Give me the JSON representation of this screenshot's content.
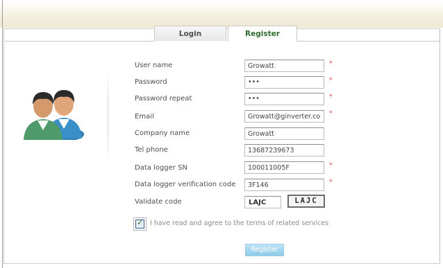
{
  "tabs": {
    "login": "Login",
    "register": "Register"
  },
  "form": {
    "rows": [
      {
        "label": "User name",
        "value": "Growatt",
        "type": "text",
        "required": true
      },
      {
        "label": "Password",
        "value": "•••",
        "type": "password",
        "required": true
      },
      {
        "label": "Password repeat",
        "value": "•••",
        "type": "password",
        "required": true
      },
      {
        "label": "Email",
        "value": "Growatt@ginverter.com",
        "type": "text",
        "required": true
      },
      {
        "label": "Company name",
        "value": "Growatt",
        "type": "text",
        "required": false
      },
      {
        "label": "Tel phone",
        "value": "13687239673",
        "type": "text",
        "required": false
      },
      {
        "label": "Data logger SN",
        "value": "100011005F",
        "type": "text",
        "required": true
      },
      {
        "label": "Data logger verification code",
        "value": "3F146",
        "type": "text",
        "required": true
      }
    ],
    "required_mark": "*",
    "validate_label": "Validate code",
    "validate_value": "LAJC",
    "captcha_text": "LAJC",
    "agree_text": "I have read and agree to the terms of related services",
    "agree_checked": true,
    "submit_label": "Register"
  },
  "colors": {
    "required": "#e04040",
    "tab_active_text": "#2e6b2e",
    "button": "#8ccbea"
  },
  "icons": {
    "avatar": "users-icon",
    "checkbox": "check-icon"
  }
}
